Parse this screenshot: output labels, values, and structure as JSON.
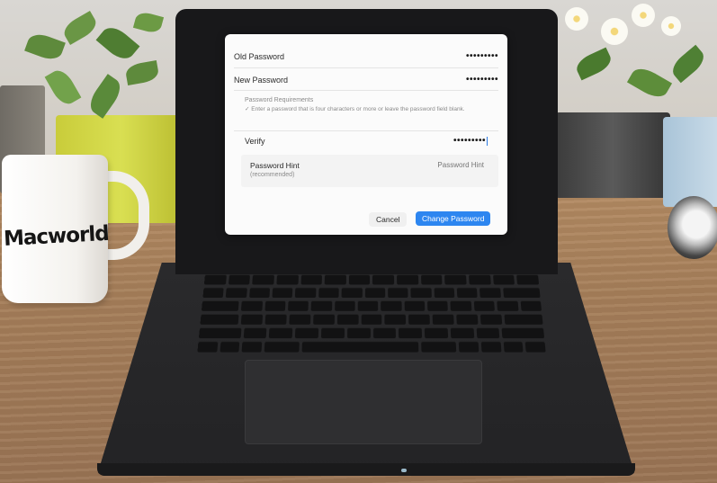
{
  "mug": {
    "logo": "Macworld"
  },
  "dialog": {
    "old_password": {
      "label": "Old Password",
      "value": "•••••••••"
    },
    "new_password": {
      "label": "New Password",
      "value": "•••••••••"
    },
    "requirements": {
      "title": "Password Requirements",
      "text": "✓ Enter a password that is four characters or more or leave the password field blank."
    },
    "verify": {
      "label": "Verify",
      "value": "•••••••••"
    },
    "hint": {
      "label": "Password Hint",
      "sublabel": "(recommended)",
      "placeholder": "Password Hint"
    },
    "buttons": {
      "cancel": "Cancel",
      "change": "Change Password"
    }
  },
  "colors": {
    "accent": "#2d86f0",
    "pot_yellow": "#d9df52",
    "desk": "#a57e59"
  }
}
